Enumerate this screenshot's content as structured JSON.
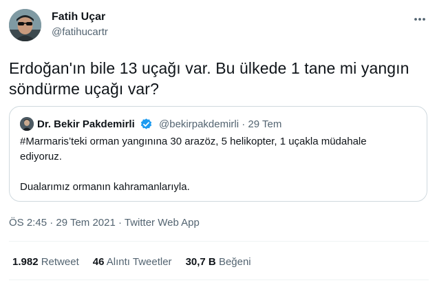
{
  "author": {
    "display_name": "Fatih Uçar",
    "handle": "@fatihucartr",
    "avatar_icon": "user-avatar-photo"
  },
  "tweet": {
    "line1": "Erdoğan'ın bile 13 uçağı var. Bu ülkede 1 tane mi yangın",
    "line2": "söndürme uçağı var?"
  },
  "quoted": {
    "display_name": "Dr. Bekir Pakdemirli",
    "verified_icon": "verified-badge-icon",
    "handle_date": "@bekirpakdemirli · 29 Tem",
    "line1": "#Marmaris’teki orman yangınına 30 arazöz, 5 helikopter, 1 uçakla müdahale",
    "line2": "ediyoruz.",
    "line3": "Dualarımız ormanın kahramanlarıyla."
  },
  "meta": "ÖS 2:45 · 29 Tem 2021 · Twitter Web App",
  "stats": {
    "retweets_count": "1.982",
    "retweets_label": "Retweet",
    "quotes_count": "46",
    "quotes_label": "Alıntı Tweetler",
    "likes_count": "30,7 B",
    "likes_label": "Beğeni"
  },
  "colors": {
    "text": "#0f1419",
    "secondary": "#536471",
    "border": "#cfd9de",
    "verified": "#1d9bf0"
  }
}
